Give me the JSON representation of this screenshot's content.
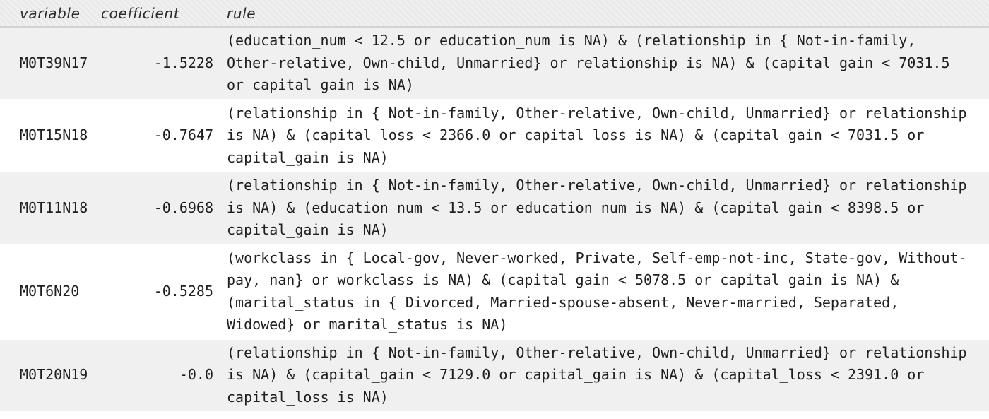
{
  "table": {
    "headers": {
      "variable": "variable",
      "coefficient": "coefficient",
      "rule": "rule"
    },
    "rows": [
      {
        "variable": "M0T39N17",
        "coefficient": "-1.5228",
        "rule": "(education_num < 12.5 or education_num is NA) & (relationship in { Not-in-family, Other-relative, Own-child, Unmarried} or relationship is NA) & (capital_gain < 7031.5 or capital_gain is NA)"
      },
      {
        "variable": "M0T15N18",
        "coefficient": "-0.7647",
        "rule": "(relationship in { Not-in-family, Other-relative, Own-child, Unmarried} or relationship is NA) & (capital_loss < 2366.0 or capital_loss is NA) & (capital_gain < 7031.5 or capital_gain is NA)"
      },
      {
        "variable": "M0T11N18",
        "coefficient": "-0.6968",
        "rule": "(relationship in { Not-in-family, Other-relative, Own-child, Unmarried} or relationship is NA) & (education_num < 13.5 or education_num is NA) & (capital_gain < 8398.5 or capital_gain is NA)"
      },
      {
        "variable": "M0T6N20",
        "coefficient": "-0.5285",
        "rule": "(workclass in { Local-gov, Never-worked, Private, Self-emp-not-inc, State-gov, Without-pay, nan} or workclass is NA) & (capital_gain < 5078.5 or capital_gain is NA) & (marital_status in { Divorced, Married-spouse-absent, Never-married, Separated, Widowed} or marital_status is NA)"
      },
      {
        "variable": "M0T20N19",
        "coefficient": "-0.0",
        "rule": "(relationship in { Not-in-family, Other-relative, Own-child, Unmarried} or relationship is NA) & (capital_gain < 7129.0 or capital_gain is NA) & (capital_loss < 2391.0 or capital_loss is NA)"
      }
    ]
  }
}
